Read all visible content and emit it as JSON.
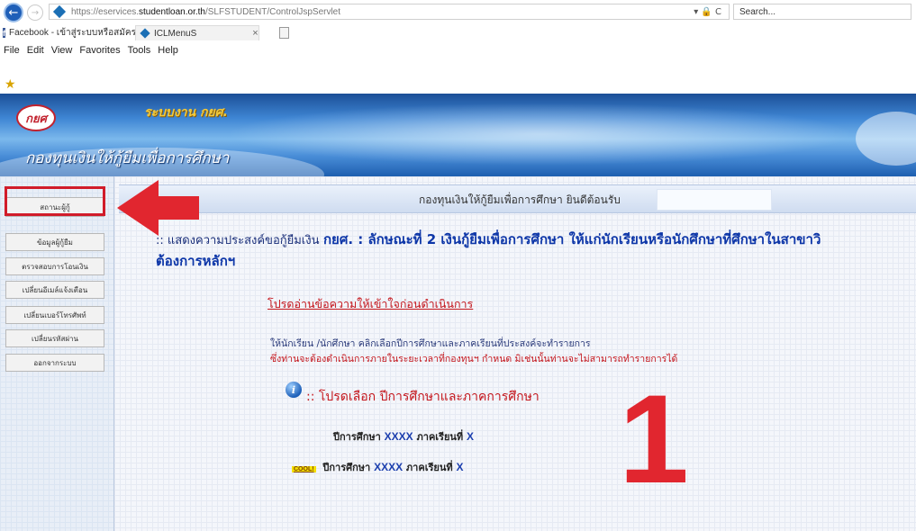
{
  "browser": {
    "url_prefix": "https://eservices.",
    "url_host": "studentloan.or.th",
    "url_path": "/SLFSTUDENT/ControlJspServlet",
    "addr_tools": "▾ 🔒 C",
    "search_placeholder": "Search...",
    "tabs": [
      {
        "label": "Facebook - เข้าสู่ระบบหรือสมัครใช้..."
      },
      {
        "label": "ICLMenuS",
        "close": "×"
      }
    ],
    "menu": [
      "File",
      "Edit",
      "View",
      "Favorites",
      "Tools",
      "Help"
    ]
  },
  "banner": {
    "logo_text": "กยศ",
    "system_label": "ระบบงาน กยศ.",
    "title": "กองทุนเงินให้กู้ยืมเพื่อการศึกษา"
  },
  "sidebar": {
    "items": [
      {
        "label": "สถานะผู้กู้"
      },
      {
        "label": "ข้อมูลผู้กู้ยืม"
      },
      {
        "label": "ตรวจสอบการโอนเงิน"
      },
      {
        "label": "เปลี่ยนอีเมล์แจ้งเตือน"
      },
      {
        "label": "เปลี่ยนเบอร์โทรศัพท์"
      },
      {
        "label": "เปลี่ยนรหัสผ่าน"
      },
      {
        "label": "ออกจากระบบ"
      }
    ]
  },
  "main": {
    "welcome": "กองทุนเงินให้กู้ยืมเพื่อการศึกษา ยินดีต้อนรับ",
    "purpose_label": ":: แสดงความประสงค์ขอกู้ยืมเงิน",
    "purpose_main": "กยศ. : ลักษณะที่ 2 เงินกู้ยืมเพื่อการศึกษา ให้แก่นักเรียนหรือนักศึกษาที่ศึกษาในสาขาวิ",
    "purpose_line2": "ต้องการหลักฯ",
    "read_notice": "โปรดอ่านข้อความให้เข้าใจก่อนดำเนินการ",
    "instruction_1": "ให้นักเรียน /นักศึกษา คลิกเลือกปีการศึกษาและภาคเรียนที่ประสงค์จะทำรายการ",
    "instruction_2": "ซึ่งท่านจะต้องดำเนินการภายในระยะเวลาที่กองทุนฯ กำหนด มิเช่นนั้นท่านจะไม่สามารถทำรายการได้",
    "select_title": ":: โปรดเลือก ปีการศึกษาและภาคการศึกษา",
    "info_icon_glyph": "i",
    "year_label": "ปีการศึกษา",
    "year_value": "XXXX",
    "semester_label": "ภาคเรียนที่",
    "semester_value": "X",
    "cool_badge": "COOL!",
    "annotation_number": "1"
  },
  "colors": {
    "highlight_red": "#d11c2a",
    "link_blue": "#0d36a8",
    "notice_red": "#c4161c"
  }
}
